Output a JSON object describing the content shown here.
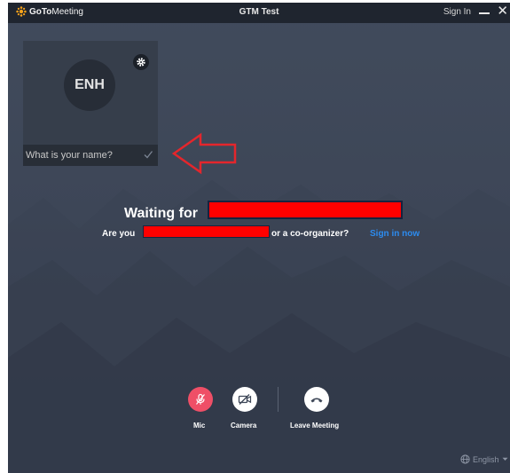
{
  "app": {
    "logo_text_bold": "GoTo",
    "logo_text_light": "Meeting",
    "window_title": "GTM Test",
    "sign_in_label": "Sign In"
  },
  "preview": {
    "initials": "ENH",
    "name_placeholder": "What is your name?"
  },
  "status": {
    "waiting_prefix": "Waiting for",
    "question_prefix": "Are you",
    "question_suffix": "or a co-organizer?",
    "sign_in_now_label": "Sign in now"
  },
  "controls": {
    "mic_label": "Mic",
    "camera_label": "Camera",
    "leave_label": "Leave Meeting"
  },
  "footer": {
    "language": "English"
  },
  "colors": {
    "window_bg": "#3d4657",
    "titlebar_bg": "#1f252f",
    "mic_muted": "#ef4f67",
    "link_blue": "#2c8cf0",
    "redaction": "#ff0000",
    "annotation_arrow": "#e4262c",
    "logo_orange": "#f7a21b"
  },
  "icons": [
    "gotomeeting-logo-icon",
    "minimize-icon",
    "close-icon",
    "gear-icon",
    "checkmark-icon",
    "arrow-annotation-icon",
    "mic-muted-icon",
    "camera-off-icon",
    "leave-meeting-icon",
    "globe-icon",
    "chevron-down-icon"
  ]
}
